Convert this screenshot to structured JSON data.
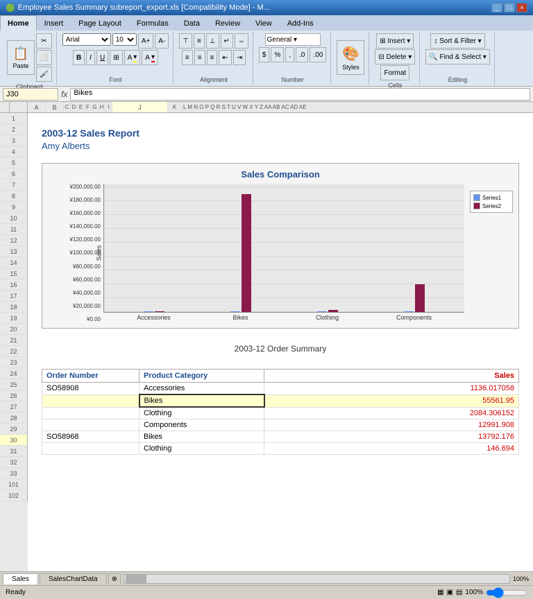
{
  "titlebar": {
    "title": "Employee Sales Summary subreport_export.xls [Compatibility Mode] - M...",
    "controls": [
      "_",
      "□",
      "×"
    ]
  },
  "ribbon": {
    "tabs": [
      "Home",
      "Insert",
      "Page Layout",
      "Formulas",
      "Data",
      "Review",
      "View",
      "Add-Ins"
    ],
    "active_tab": "Home",
    "groups": {
      "clipboard": "Clipboard",
      "font": "Font",
      "alignment": "Alignment",
      "number": "Number",
      "styles": "Styles",
      "cells": "Cells",
      "editing": "Editing"
    },
    "format_label": "Format"
  },
  "formula_bar": {
    "cell": "J30",
    "value": "Bikes"
  },
  "spreadsheet": {
    "col_headers": [
      "",
      "A",
      "B",
      "C",
      "D",
      "E",
      "F",
      "G",
      "H",
      "I",
      "J",
      "K",
      "L",
      "M",
      "N",
      "O",
      "P",
      "Q",
      "R",
      "S",
      "T",
      "U",
      "V",
      "W",
      "X",
      "Y",
      "Z",
      "AA",
      "AB",
      "AC",
      "AD",
      "AE"
    ],
    "rows": [
      1,
      2,
      3,
      4,
      5,
      6,
      7,
      8,
      9,
      10,
      11,
      12,
      13,
      14,
      15,
      16,
      17,
      18,
      19,
      20,
      21,
      22,
      23,
      24,
      25,
      26,
      27,
      28,
      29,
      30,
      31,
      32,
      33,
      101,
      102
    ]
  },
  "report": {
    "title": "2003-12 Sales Report",
    "subtitle": "Amy Alberts",
    "chart_title": "Sales Comparison",
    "order_summary_title": "2003-12 Order Summary"
  },
  "chart": {
    "y_labels": [
      "¥200,000.00",
      "¥180,000.00",
      "¥160,000.00",
      "¥140,000.00",
      "¥120,000.00",
      "¥100,000.00",
      "¥80,000.00",
      "¥60,000.00",
      "¥40,000.00",
      "¥20,000.00",
      "¥0.00"
    ],
    "x_labels": [
      "Accessories",
      "Bikes",
      "Clothing",
      "Components"
    ],
    "y_axis_label": "Sales",
    "legend": {
      "series1": "Series1",
      "series2": "Series2"
    },
    "bars": {
      "accessories": {
        "s1": 0,
        "s2": 1
      },
      "bikes": {
        "s1": 0,
        "s2": 170
      },
      "clothing": {
        "s1": 0,
        "s2": 3
      },
      "components": {
        "s1": 0,
        "s2": 40
      }
    },
    "colors": {
      "series1": "#6495ed",
      "series2": "#8b1a4a"
    }
  },
  "table": {
    "headers": [
      "Order Number",
      "Product Category",
      "Sales"
    ],
    "rows": [
      {
        "order": "SO58908",
        "category": "Accessories",
        "sales": "1136.017058",
        "active": false
      },
      {
        "order": "",
        "category": "Bikes",
        "sales": "55561.95",
        "active": true
      },
      {
        "order": "",
        "category": "Clothing",
        "sales": "2084.306152",
        "active": false
      },
      {
        "order": "",
        "category": "Components",
        "sales": "12991.908",
        "active": false
      },
      {
        "order": "SO58968",
        "category": "Bikes",
        "sales": "13792.176",
        "active": false
      },
      {
        "order": "",
        "category": "Clothing",
        "sales": "146.694",
        "active": false
      }
    ]
  },
  "sheet_tabs": [
    "Sales",
    "SalesChartData"
  ],
  "status": "Ready",
  "zoom": "100%"
}
